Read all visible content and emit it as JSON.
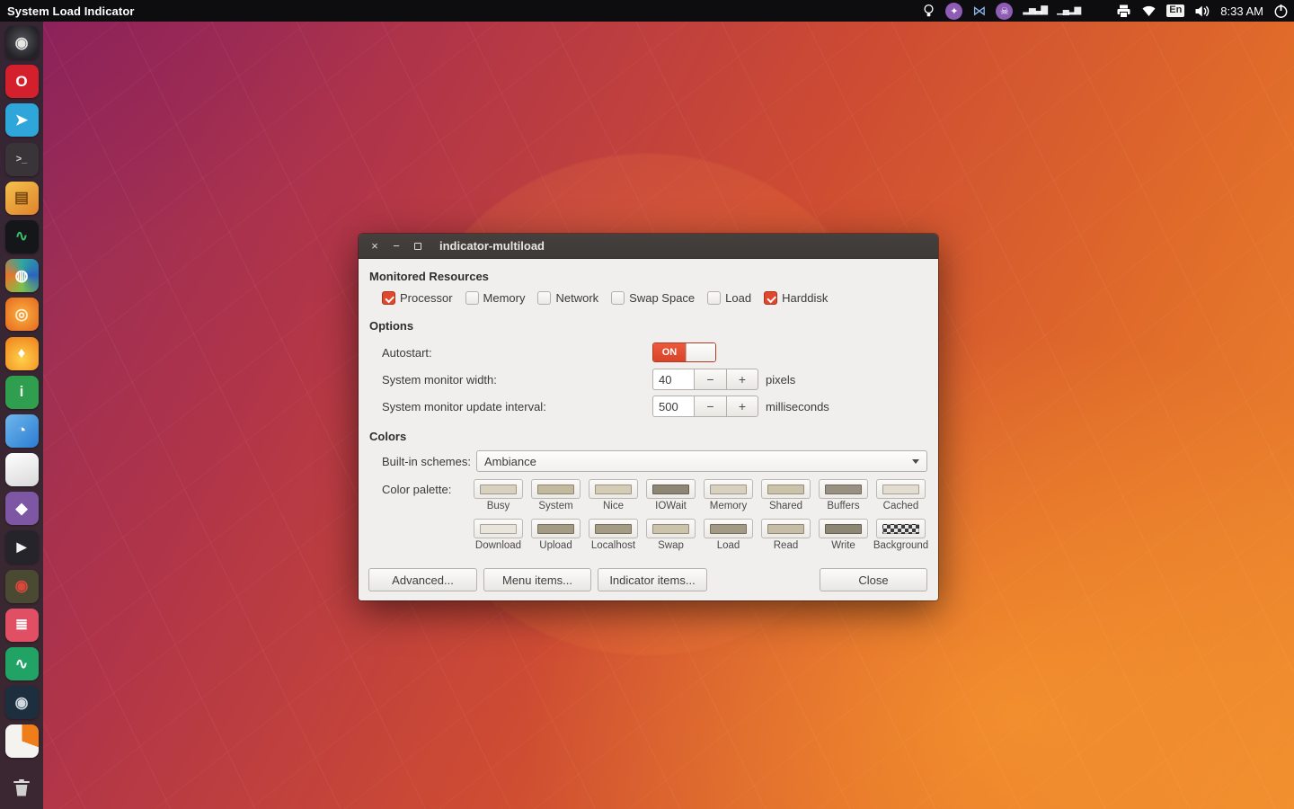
{
  "topbar": {
    "app_title": "System Load Indicator",
    "keyboard_layout": "En",
    "clock": "8:33 AM",
    "graph1": "▂▅▃▇",
    "graph2": "▁▄▂▆",
    "badge1_glyph": "✦",
    "badge2_glyph": "☠",
    "blue_glyph": "⋈"
  },
  "launcher": [
    {
      "name": "dash-home",
      "bg": "radial-gradient(circle at 50% 45%, #57565c, #232227 72%)",
      "glyph": "◉",
      "fg": "#e8e6e3"
    },
    {
      "name": "opera",
      "bg": "#d41f2c",
      "glyph": "O",
      "fg": "#ffffff"
    },
    {
      "name": "telegram",
      "bg": "#2ea6d9",
      "glyph": "➤",
      "fg": "#ffffff"
    },
    {
      "name": "terminal",
      "bg": "#383438",
      "glyph": ">_",
      "fg": "#cfd2d4"
    },
    {
      "name": "files",
      "bg": "linear-gradient(145deg,#f3c24b,#e0822c)",
      "glyph": "▤",
      "fg": "#7a4a12"
    },
    {
      "name": "system-monitor",
      "bg": "#14161a",
      "glyph": "∿",
      "fg": "#35c26b"
    },
    {
      "name": "browser",
      "bg": "conic-gradient(from 0deg,#2fa7a0,#2a65c0,#7cc24a,#e8762c,#2fa7a0)",
      "glyph": "◍",
      "fg": "#ffffff"
    },
    {
      "name": "music-app",
      "bg": "radial-gradient(circle,#f59b35 30%,#e4671f)",
      "glyph": "◎",
      "fg": "#fff4e0"
    },
    {
      "name": "flame-app",
      "bg": "radial-gradient(circle at 50% 65%,#ffd24a,#ef7d1a)",
      "glyph": "♦",
      "fg": "#ffffff"
    },
    {
      "name": "info-app",
      "bg": "#2f9e4f",
      "glyph": "i",
      "fg": "#eaf6ec"
    },
    {
      "name": "blue-app",
      "bg": "linear-gradient(135deg,#6fb7ec,#2b7cd3)",
      "glyph": "◔",
      "fg": "#ffffff"
    },
    {
      "name": "white-app",
      "bg": "linear-gradient(160deg,#ffffff,#d9d9d9)",
      "glyph": "",
      "fg": "#888888"
    },
    {
      "name": "purple-app",
      "bg": "#7e57a4",
      "glyph": "◆",
      "fg": "#ffffff"
    },
    {
      "name": "media-player",
      "bg": "#26242b",
      "glyph": "▶",
      "fg": "#f2f2f2"
    },
    {
      "name": "olive-app",
      "bg": "#4a4a33",
      "glyph": "◉",
      "fg": "#d9483b"
    },
    {
      "name": "pink-app",
      "bg": "#e04f63",
      "glyph": "≣",
      "fg": "#ffffff"
    },
    {
      "name": "health-monitor",
      "bg": "#21a366",
      "glyph": "∿",
      "fg": "#ffffff"
    },
    {
      "name": "steam",
      "bg": "#1d2f3f",
      "glyph": "◉",
      "fg": "#cfd8e0"
    },
    {
      "name": "usage-pie",
      "bg": "conic-gradient(#ef7d1a 0 110deg,#f5f3ef 110deg 360deg)",
      "glyph": "",
      "fg": "#ffffff"
    }
  ],
  "window": {
    "title": "indicator-multiload",
    "controls": {
      "close": "×",
      "minimize": "−"
    },
    "sections": {
      "monitored": "Monitored Resources",
      "options": "Options",
      "colors": "Colors"
    },
    "resources": [
      {
        "label": "Processor",
        "checked": true
      },
      {
        "label": "Memory",
        "checked": false
      },
      {
        "label": "Network",
        "checked": false
      },
      {
        "label": "Swap Space",
        "checked": false
      },
      {
        "label": "Load",
        "checked": false
      },
      {
        "label": "Harddisk",
        "checked": true
      }
    ],
    "options": {
      "autostart_label": "Autostart:",
      "autostart_state": "ON",
      "width_label": "System monitor width:",
      "width_value": "40",
      "width_unit": "pixels",
      "interval_label": "System monitor update interval:",
      "interval_value": "500",
      "interval_unit": "milliseconds",
      "minus": "−",
      "plus": "+"
    },
    "colors": {
      "schemes_label": "Built-in schemes:",
      "scheme_value": "Ambiance",
      "palette_label": "Color palette:",
      "palette": [
        {
          "label": "Busy",
          "color": "#d8d1c0"
        },
        {
          "label": "System",
          "color": "#c3b99e"
        },
        {
          "label": "Nice",
          "color": "#d5ccb6"
        },
        {
          "label": "IOWait",
          "color": "#8d8675"
        },
        {
          "label": "Memory",
          "color": "#d8d1c0"
        },
        {
          "label": "Shared",
          "color": "#cbc2aa"
        },
        {
          "label": "Buffers",
          "color": "#989182"
        },
        {
          "label": "Cached",
          "color": "#e3ddcf"
        },
        {
          "label": "Download",
          "color": "#e9e5da"
        },
        {
          "label": "Upload",
          "color": "#a59b84"
        },
        {
          "label": "Localhost",
          "color": "#a59b84"
        },
        {
          "label": "Swap",
          "color": "#ccc3ab"
        },
        {
          "label": "Load",
          "color": "#a39a85"
        },
        {
          "label": "Read",
          "color": "#c7bda6"
        },
        {
          "label": "Write",
          "color": "#8d8675"
        },
        {
          "label": "Background",
          "color": "checkerboard"
        }
      ]
    },
    "buttons": {
      "advanced": "Advanced...",
      "menu_items": "Menu items...",
      "indicator_items": "Indicator items...",
      "close": "Close"
    }
  }
}
